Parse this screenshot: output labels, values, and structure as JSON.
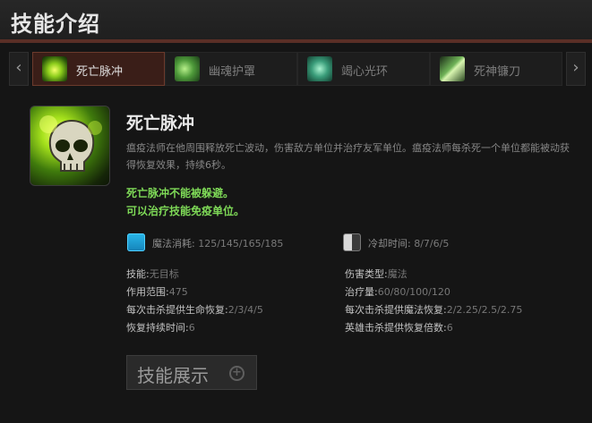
{
  "header": {
    "title": "技能介绍"
  },
  "tabs": [
    {
      "label": "死亡脉冲",
      "icon": "death-pulse-skull-icon",
      "active": true
    },
    {
      "label": "幽魂护罩",
      "icon": "ghost-shroud-icon",
      "active": false
    },
    {
      "label": "竭心光环",
      "icon": "heartstopper-aura-icon",
      "active": false
    },
    {
      "label": "死神镰刀",
      "icon": "reapers-scythe-icon",
      "active": false
    }
  ],
  "skill": {
    "name": "死亡脉冲",
    "description": "瘟疫法师在他周围释放死亡波动，伤害敌方单位并治疗友军单位。瘟疫法师每杀死一个单位都能被动获得恢复效果，持续6秒。",
    "notes": [
      "死亡脉冲不能被躲避。",
      "可以治疗技能免疫单位。"
    ],
    "mana_label": "魔法消耗:",
    "mana_value": "125/145/165/185",
    "cooldown_label": "冷却时间:",
    "cooldown_value": "8/7/6/5",
    "attributes_left": [
      {
        "label": "技能:",
        "value": "无目标"
      },
      {
        "label": "作用范围:",
        "value": "475"
      },
      {
        "label": "每次击杀提供生命恢复:",
        "value": "2/3/4/5"
      },
      {
        "label": "恢复持续时间:",
        "value": "6"
      }
    ],
    "attributes_right": [
      {
        "label": "伤害类型:",
        "value": "魔法"
      },
      {
        "label": "治疗量:",
        "value": "60/80/100/120"
      },
      {
        "label": "每次击杀提供魔法恢复:",
        "value": "2/2.25/2.5/2.75"
      },
      {
        "label": "英雄击杀提供恢复倍数:",
        "value": "6"
      }
    ]
  },
  "demo_button": {
    "label": "技能展示"
  },
  "colors": {
    "accent": "#5a2f26",
    "note_green": "#7ed957",
    "mana_blue": "#28b7ea"
  }
}
